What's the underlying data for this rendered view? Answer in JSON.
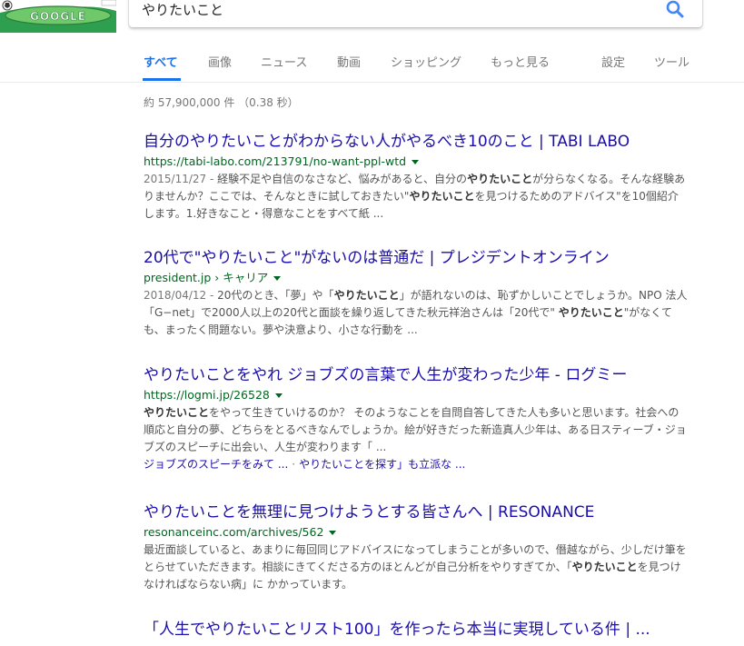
{
  "search": {
    "query": "やりたいこと"
  },
  "tabs": [
    {
      "label": "すべて"
    },
    {
      "label": "画像"
    },
    {
      "label": "ニュース"
    },
    {
      "label": "動画"
    },
    {
      "label": "ショッピング"
    },
    {
      "label": "もっと見る"
    },
    {
      "label": "設定"
    },
    {
      "label": "ツール"
    }
  ],
  "stats": "約 57,900,000 件 （0.38 秒）",
  "results": [
    {
      "title": "自分のやりたいことがわからない人がやるべき10のこと | TABI LABO",
      "url": "https://tabi-labo.com/213791/no-want-ppl-wtd",
      "date": "2015/11/27 - ",
      "snippet_parts": [
        "経験不足や自信のなさなど、悩みがあると、自分の",
        "やりたいこと",
        "が分らなくなる。そんな経験ありませんか？ここでは、そんなときに試しておきたい\"",
        "やりたいこと",
        "を見つけるためのアドバイス\"を10個紹介します。1.好きなこと・得意なことをすべて紙 ..."
      ]
    },
    {
      "title": "20代で\"やりたいこと\"がないのは普通だ | プレジデントオンライン",
      "url": "president.jp › キャリア",
      "date": "2018/04/12 - ",
      "snippet_parts": [
        "20代のとき、「夢」や「",
        "やりたいこと",
        "」が語れないのは、恥ずかしいことでしょうか。NPO 法人「G−net」で2000人以上の20代と面談を繰り返してきた秋元祥治さんは「20代で\" ",
        "やりたいこと",
        "\"がなくても、まったく問題ない。夢や決意より、小さな行動を ..."
      ]
    },
    {
      "title": "やりたいことをやれ ジョブズの言葉で人生が変わった少年 - ログミー",
      "url": "https://logmi.jp/26528",
      "date": "",
      "snippet_parts": [
        "",
        "やりたいこと",
        "をやって生きていけるのか？ そのようなことを自問自答してきた人も多いと思います。社会への順応と自分の夢、どちらをとるべきなんでしょうか。絵が好きだった新造真人少年は、ある日スティーブ・ジョブズのスピーチに出会い、人生が変わります「 ...",
        "",
        ""
      ],
      "sitelinks": [
        "ジョブズのスピーチをみて ...",
        "やりたいことを探す」も立派な ..."
      ]
    },
    {
      "title": "やりたいことを無理に見つけようとする皆さんへ | RESONANCE",
      "url": "resonanceinc.com/archives/562",
      "date": "",
      "snippet_parts": [
        "最近面談していると、あまりに毎回同じアドバイスになってしまうことが多いので、僭越ながら、少しだけ筆をとらせていただきます。相談にきてくださる方のほとんどが自己分析をやりすぎてか、「",
        "やりたいこと",
        "を見つけなければならない病」に かかっています。",
        "",
        ""
      ]
    },
    {
      "title": "「人生でやりたいことリスト100」を作ったら本当に実現している件 | ...",
      "url": "",
      "date": "",
      "snippet_parts": [
        "",
        "",
        "",
        "",
        ""
      ]
    }
  ]
}
